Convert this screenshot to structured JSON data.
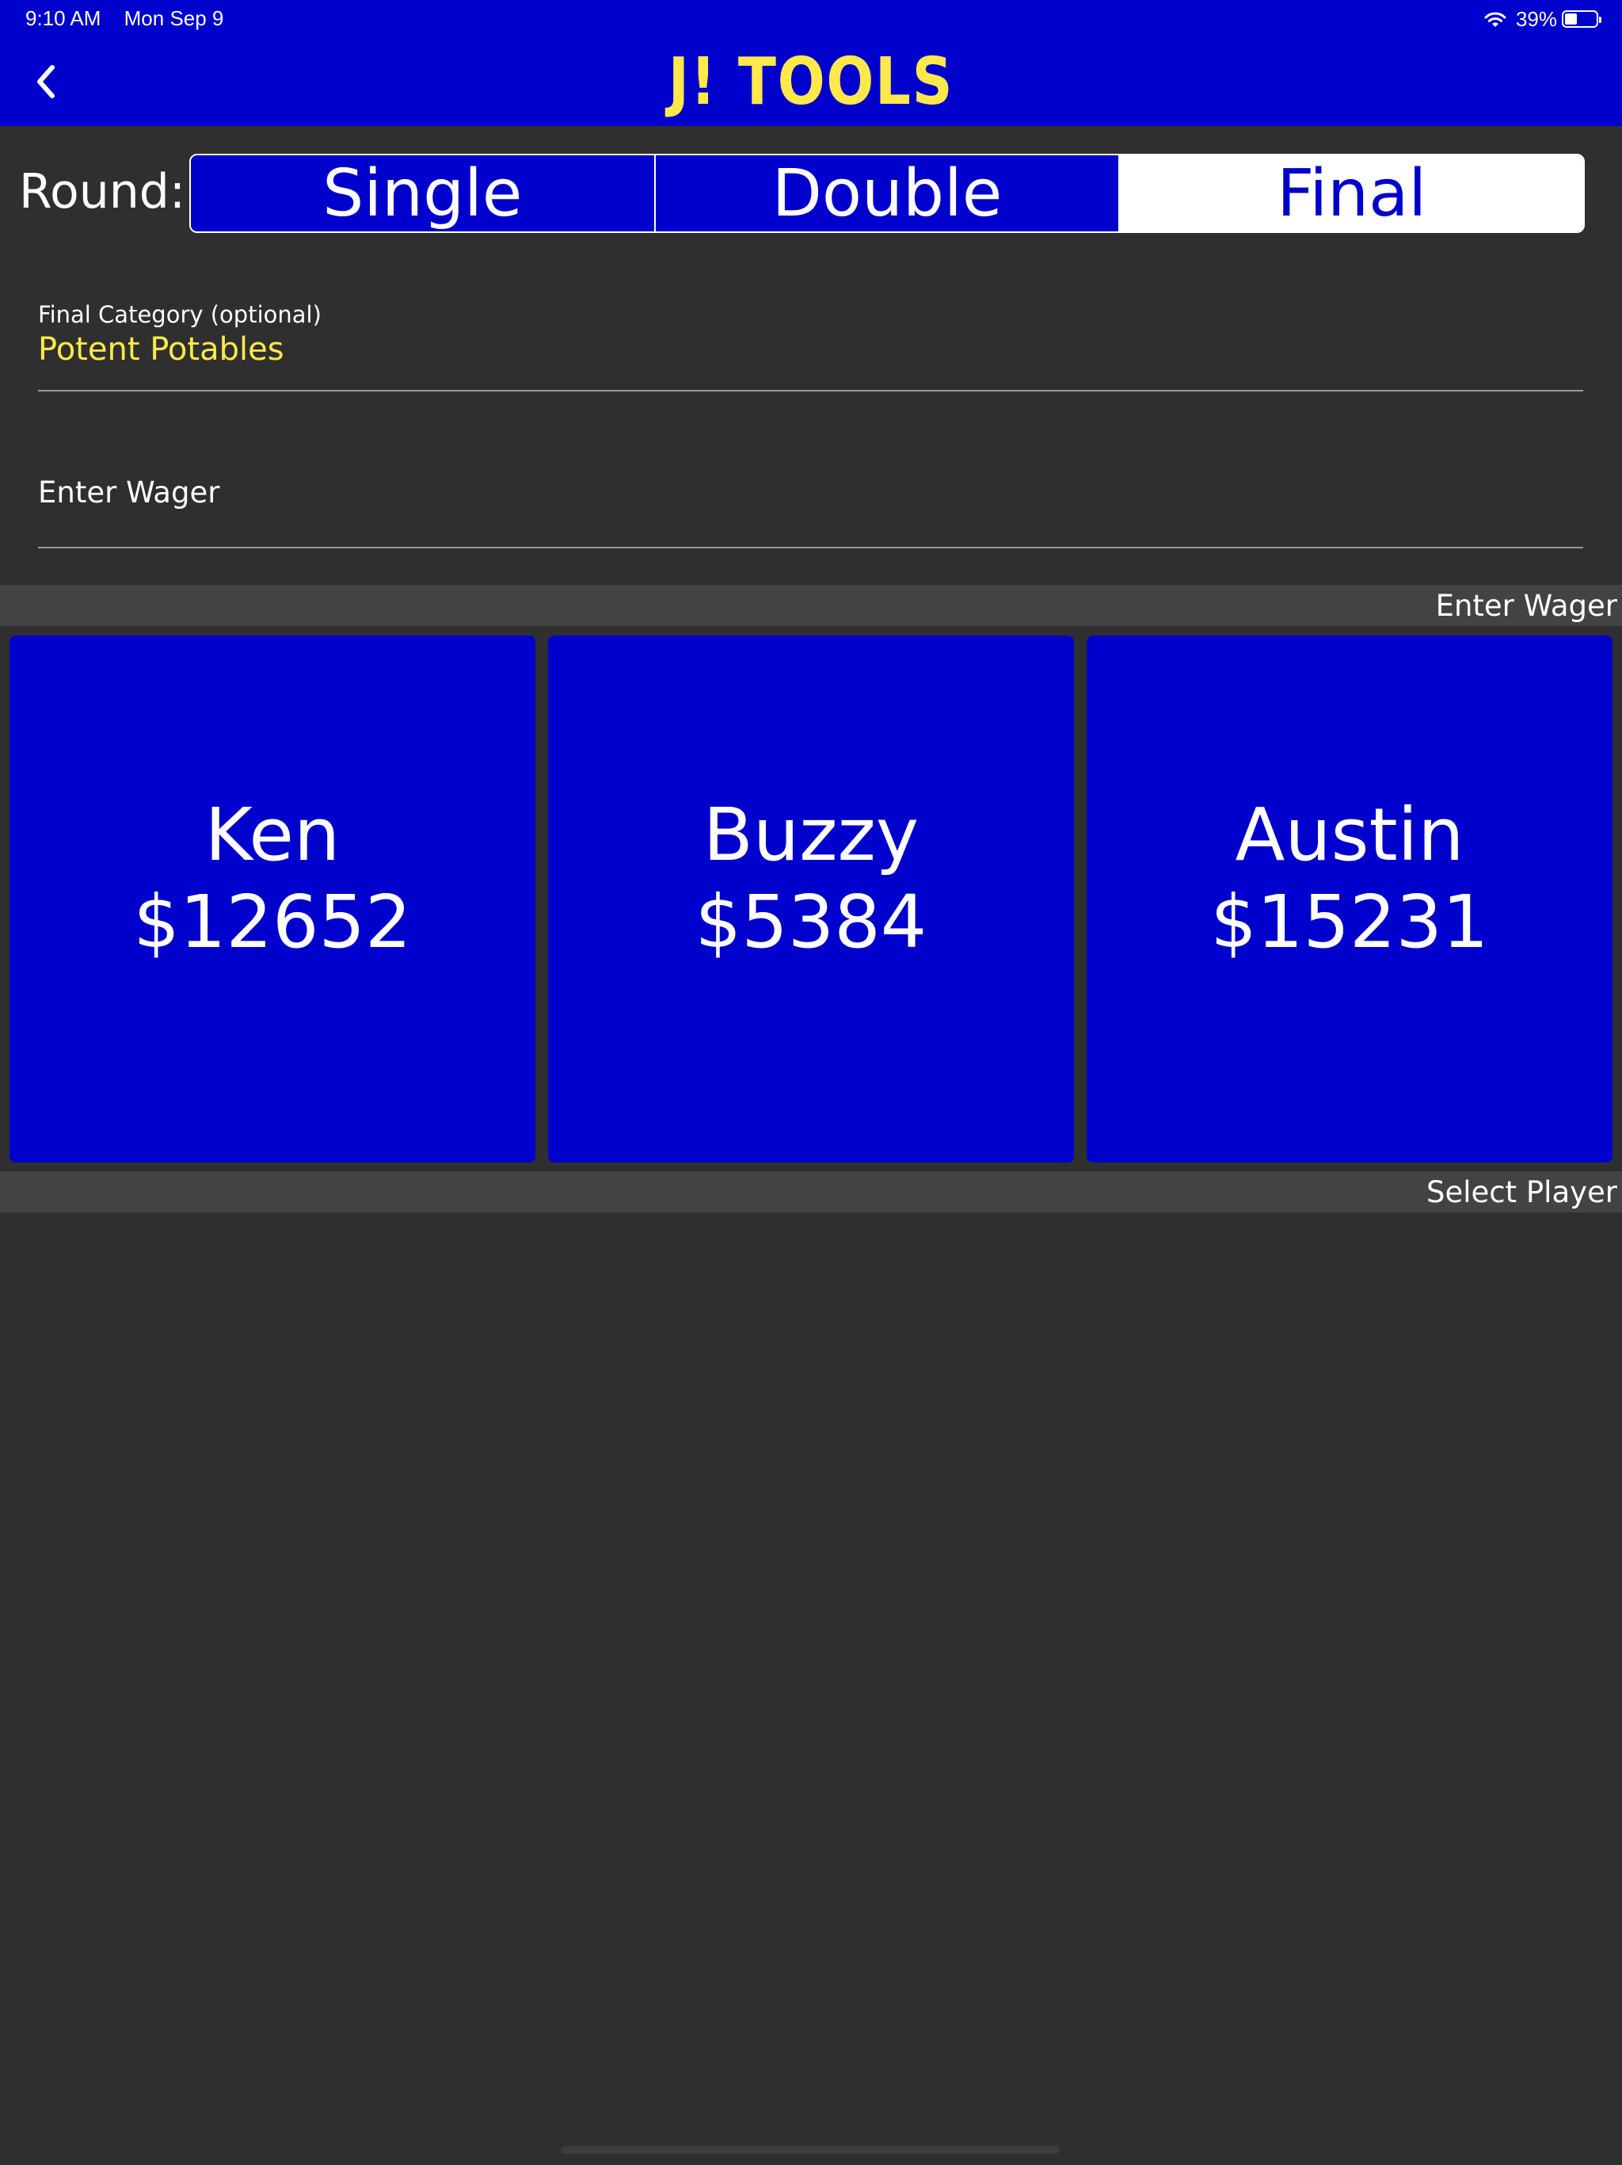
{
  "status_bar": {
    "time": "9:10 AM",
    "date": "Mon Sep 9",
    "battery_percent": "39%",
    "battery_level": 0.39
  },
  "nav": {
    "title": "J! TOOLS",
    "back_icon": "chevron-left-icon"
  },
  "round": {
    "label": "Round:",
    "options": [
      "Single",
      "Double",
      "Final"
    ],
    "selected": "Final"
  },
  "category_field": {
    "label": "Final Category (optional)",
    "value": "Potent Potables"
  },
  "wager_field": {
    "placeholder": "Enter Wager"
  },
  "sections": {
    "wager_header": "Enter Wager",
    "player_header": "Select Player"
  },
  "players": [
    {
      "name": "Ken",
      "score": "$12652"
    },
    {
      "name": "Buzzy",
      "score": "$5384"
    },
    {
      "name": "Austin",
      "score": "$15231"
    }
  ],
  "colors": {
    "brand_blue": "#0000cc",
    "accent_yellow": "#ffe94a",
    "background": "#2f2f2f",
    "section_header": "#434343"
  }
}
